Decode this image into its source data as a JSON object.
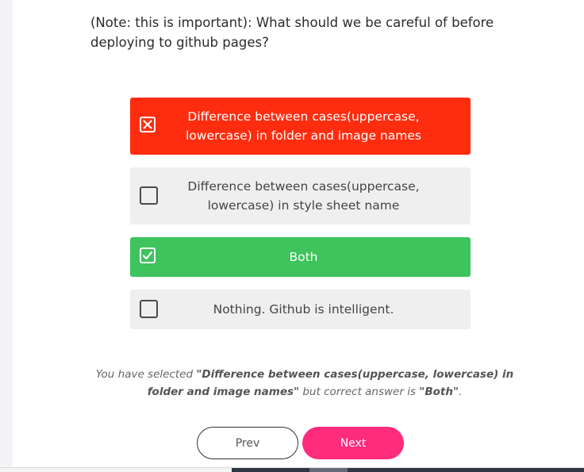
{
  "question": "(Note: this is important): What should we be careful of before deploying to github pages?",
  "options": [
    {
      "label": "Difference between cases(uppercase, lowercase) in folder and image names",
      "state": "selected-wrong",
      "icon": "x-icon"
    },
    {
      "label": "Difference between cases(uppercase, lowercase) in style sheet name",
      "state": "unselected",
      "icon": ""
    },
    {
      "label": "Both",
      "state": "correct",
      "icon": "check-icon"
    },
    {
      "label": "Nothing. Github is intelligent.",
      "state": "unselected",
      "icon": ""
    }
  ],
  "result": {
    "prefix": "You have selected ",
    "selected": "\"Difference between cases(uppercase, lowercase) in folder and image names\"",
    "middle": " but correct answer is ",
    "correct": "\"Both\"",
    "suffix": "."
  },
  "buttons": {
    "prev": "Prev",
    "next": "Next"
  },
  "colors": {
    "wrong": "#ff2d0f",
    "correct": "#3ec35d",
    "next_button": "#ff2c7c",
    "option_bg": "#efefef"
  }
}
